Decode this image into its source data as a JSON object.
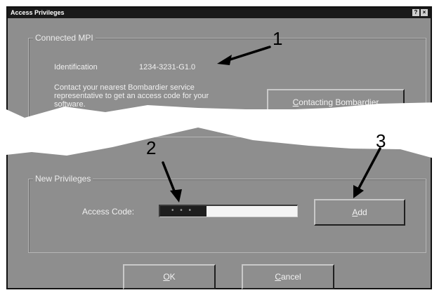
{
  "window": {
    "title": "Access Privileges",
    "help_glyph": "?",
    "close_glyph": "×"
  },
  "connected_mpi": {
    "legend": "Connected MPI",
    "identification_label": "Identification",
    "identification_value": "1234-3231-G1.0",
    "contact_text_line1": "Contact your nearest Bombardier service",
    "contact_text_line2": "representative to get an access code for your",
    "contact_text_line3": "software.",
    "contact_button": {
      "mnemonic": "C",
      "rest": "ontacting Bombardier"
    }
  },
  "new_privileges": {
    "legend": "New Privileges",
    "access_code_label": "Access Code:",
    "access_code_value": "• • •",
    "add_button": {
      "mnemonic": "A",
      "rest": "dd"
    }
  },
  "footer": {
    "ok_button": {
      "mnemonic": "O",
      "rest": "K"
    },
    "cancel_button": {
      "mnemonic": "C",
      "rest": "ancel"
    }
  },
  "callouts": {
    "one": "1",
    "two": "2",
    "three": "3"
  },
  "colors": {
    "dialog_bg": "#8e8e8e",
    "titlebar": "#1a1a1a",
    "tear": "#ffffff"
  }
}
